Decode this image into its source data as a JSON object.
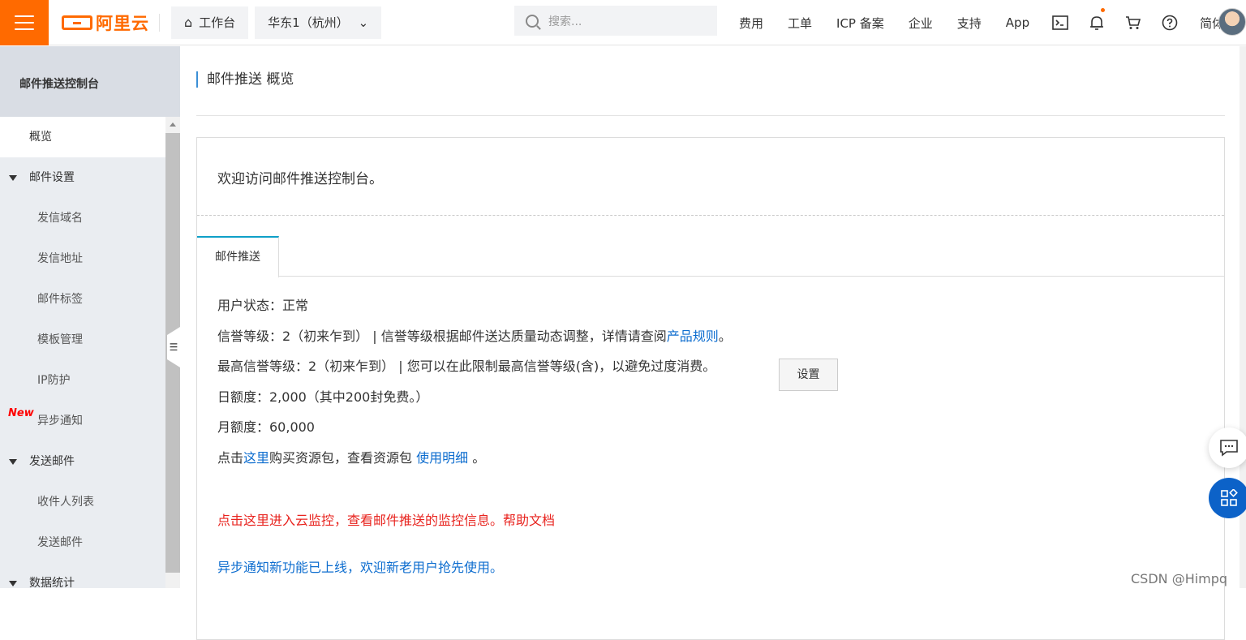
{
  "header": {
    "logo_text": "阿里云",
    "workbench_label": "工作台",
    "region_label": "华东1（杭州）",
    "search_placeholder": "搜索...",
    "links": [
      "费用",
      "工单",
      "ICP 备案",
      "企业",
      "支持",
      "App"
    ],
    "lang_label": "简体",
    "icons": [
      "terminal-icon",
      "bell-icon",
      "cart-icon",
      "help-icon"
    ],
    "accent": "#ff6a00"
  },
  "sidebar": {
    "title": "邮件推送控制台",
    "items": [
      {
        "label": "概览",
        "type": "active"
      },
      {
        "label": "邮件设置",
        "type": "group"
      },
      {
        "label": "发信域名",
        "type": "sub"
      },
      {
        "label": "发信地址",
        "type": "sub"
      },
      {
        "label": "邮件标签",
        "type": "sub"
      },
      {
        "label": "模板管理",
        "type": "sub"
      },
      {
        "label": "IP防护",
        "type": "sub"
      },
      {
        "label": "异步通知",
        "type": "sub",
        "badge": "New"
      },
      {
        "label": "发送邮件",
        "type": "group"
      },
      {
        "label": "收件人列表",
        "type": "sub"
      },
      {
        "label": "发送邮件",
        "type": "sub"
      },
      {
        "label": "数据统计",
        "type": "group"
      }
    ]
  },
  "main": {
    "title": "邮件推送 概览",
    "welcome": "欢迎访问邮件推送控制台。",
    "tab_label": "邮件推送",
    "user_status": "用户状态：正常",
    "credit_level_prefix": "信誉等级：2（初来乍到） | 信誉等级根据邮件送达质量动态调整，详情请查阅",
    "credit_level_link": "产品规则",
    "credit_level_suffix": "。",
    "max_level": "最高信誉等级：2（初来乍到） | 您可以在此限制最高信誉等级(含)，以避免过度消费。",
    "set_button": "设置",
    "daily_quota": "日额度：2,000（其中200封免费。）",
    "monthly_quota": "月额度：60,000",
    "buy_prefix": "点击",
    "buy_link": "这里",
    "buy_middle": "购买资源包，查看资源包 ",
    "usage_link": "使用明细",
    "buy_suffix": " 。",
    "monitor_line": "点击这里进入云监控，查看邮件推送的监控信息。帮助文档",
    "async_line": "异步通知新功能已上线，欢迎新老用户抢先使用。"
  },
  "watermark": "CSDN @Himpq"
}
